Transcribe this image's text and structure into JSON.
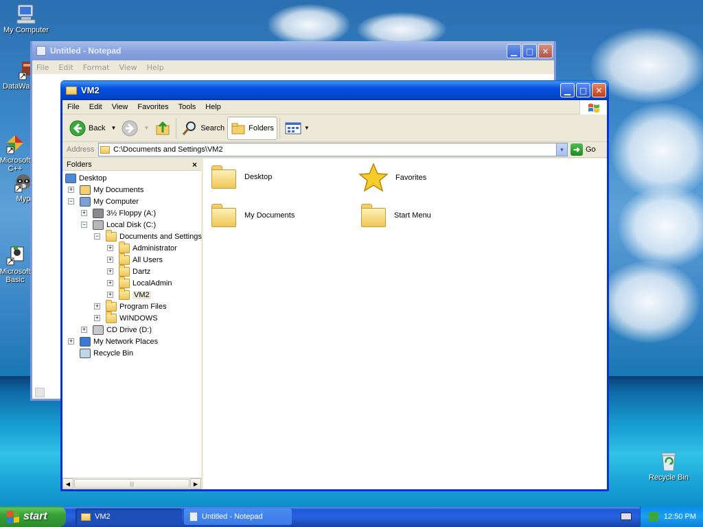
{
  "desktop": {
    "icons": [
      {
        "label": "My Computer"
      },
      {
        "label": "DataWar"
      },
      {
        "label": "Microsoft\nC++"
      },
      {
        "label": "Myp"
      },
      {
        "label": "Microsoft\nBasic"
      },
      {
        "label": "Recycle Bin"
      }
    ]
  },
  "notepad": {
    "title": "Untitled - Notepad",
    "menu": [
      "File",
      "Edit",
      "Format",
      "View",
      "Help"
    ]
  },
  "explorer": {
    "title": "VM2",
    "menu": [
      "File",
      "Edit",
      "View",
      "Favorites",
      "Tools",
      "Help"
    ],
    "toolbar": {
      "back": "Back",
      "search": "Search",
      "folders": "Folders"
    },
    "address": {
      "label": "Address",
      "value": "C:\\Documents and Settings\\VM2",
      "go": "Go"
    },
    "folders_pane": {
      "header": "Folders",
      "close": "×",
      "tree": [
        {
          "label": "Desktop",
          "expander": "",
          "icon": "desktop-icon"
        },
        {
          "label": "My Documents",
          "expander": "+",
          "icon": "my-documents-icon"
        },
        {
          "label": "My Computer",
          "expander": "−",
          "icon": "my-computer-icon"
        },
        {
          "label": "3½ Floppy (A:)",
          "expander": "+",
          "icon": "floppy-drive-icon"
        },
        {
          "label": "Local Disk (C:)",
          "expander": "−",
          "icon": "hard-disk-icon"
        },
        {
          "label": "Documents and Settings",
          "expander": "−",
          "icon": "folder-icon"
        },
        {
          "label": "Administrator",
          "expander": "+",
          "icon": "folder-icon"
        },
        {
          "label": "All Users",
          "expander": "+",
          "icon": "folder-icon"
        },
        {
          "label": "Dartz",
          "expander": "+",
          "icon": "folder-icon"
        },
        {
          "label": "LocalAdmin",
          "expander": "+",
          "icon": "folder-icon"
        },
        {
          "label": "VM2",
          "expander": "+",
          "icon": "folder-open-icon",
          "selected": true
        },
        {
          "label": "Program Files",
          "expander": "+",
          "icon": "folder-icon"
        },
        {
          "label": "WINDOWS",
          "expander": "+",
          "icon": "folder-icon"
        },
        {
          "label": "CD Drive (D:)",
          "expander": "+",
          "icon": "cd-drive-icon"
        },
        {
          "label": "My Network Places",
          "expander": "+",
          "icon": "network-places-icon"
        },
        {
          "label": "Recycle Bin",
          "expander": "",
          "icon": "recycle-bin-icon"
        }
      ]
    },
    "items": [
      {
        "label": "Desktop",
        "icon": "folder-icon"
      },
      {
        "label": "Favorites",
        "icon": "star-icon"
      },
      {
        "label": "My Documents",
        "icon": "folder-icon"
      },
      {
        "label": "Start Menu",
        "icon": "folder-icon"
      }
    ]
  },
  "taskbar": {
    "start": "start",
    "tasks": [
      {
        "label": "VM2",
        "active": true
      },
      {
        "label": "Untitled - Notepad",
        "active": false
      }
    ],
    "clock": "12:50 PM"
  },
  "colors": {
    "xp_blue": "#0831d9",
    "start_green": "#37a337",
    "tray_blue": "#1aa0f2"
  }
}
